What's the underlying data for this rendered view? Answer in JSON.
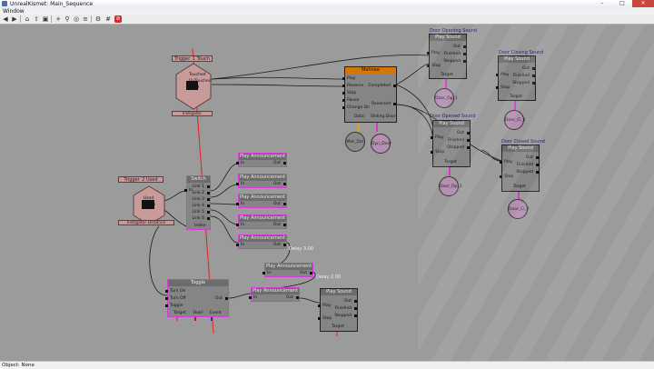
{
  "window": {
    "title": "UnrealKismet: Main_Sequence",
    "min_label": "–",
    "max_label": "□",
    "close_label": "✕"
  },
  "menu": {
    "window_label": "Window"
  },
  "toolbar": {
    "icons": [
      "back-icon",
      "forward-icon",
      "home-icon",
      "parent-icon",
      "open-icon",
      "zoom-in-icon",
      "search-icon",
      "find-icon",
      "settings-icon",
      "delete-icon"
    ]
  },
  "status": {
    "text": "Object: None"
  },
  "nodes": {
    "trigger1": {
      "label": "Trigger_1 Touch",
      "pins": [
        "Touched",
        "UnTouched",
        "Used"
      ],
      "bottom": "Instigator"
    },
    "trigger2": {
      "label": "Trigger_2 Used",
      "pins": [
        "Used",
        "Touch"
      ],
      "bottom": "Instigator     Distance"
    },
    "matinee": {
      "label": "Matinee",
      "in_pins": [
        "Play",
        "Reverse",
        "Stop",
        "Pause",
        "Change Dir"
      ],
      "out_pins": [
        "Completed",
        "Reversed"
      ],
      "vars": [
        "Data",
        "Sliding Door"
      ]
    },
    "switch": {
      "label": "Switch",
      "in_pins": [
        "In"
      ],
      "out_pins": [
        "Link 1",
        "Link 2",
        "Link 3",
        "Link 4",
        "Link 5",
        "Link 6"
      ],
      "bottom": "Index"
    },
    "toggle": {
      "label": "Toggle",
      "in_pins": [
        "Turn On",
        "Turn Off",
        "Toggle"
      ],
      "out_pins": [
        "Out"
      ],
      "vars": [
        "Target",
        "Bool",
        "Event"
      ]
    },
    "announce": [
      {
        "label": "Play Announcement",
        "in": "In",
        "out": "Out"
      },
      {
        "label": "Play Announcement",
        "in": "In",
        "out": "Out"
      },
      {
        "label": "Play Announcement",
        "in": "In",
        "out": "Out"
      },
      {
        "label": "Play Announcement",
        "in": "In",
        "out": "Out"
      },
      {
        "label": "Play Announcement",
        "in": "In",
        "out": "Out"
      },
      {
        "label": "Play Announcement",
        "in": "In",
        "out": "Out"
      },
      {
        "label": "Play Announcement",
        "in": "In",
        "out": "Out"
      }
    ],
    "sounds": [
      {
        "title": "Door Opening Sound",
        "label": "Play Sound",
        "in_pins": [
          "Play",
          "Stop"
        ],
        "out_pins": [
          "Out",
          "Finished",
          "Stopped"
        ],
        "target": "Target",
        "var": "Door_Op_1"
      },
      {
        "title": "Door Closing Sound",
        "label": "Play Sound",
        "in_pins": [
          "Play",
          "Stop"
        ],
        "out_pins": [
          "Out",
          "Finished",
          "Stopped"
        ],
        "target": "Target",
        "var": "Door_Cl_1"
      },
      {
        "title": "Door Opened Sound",
        "label": "Play Sound",
        "in_pins": [
          "Play",
          "Stop"
        ],
        "out_pins": [
          "Out",
          "Finished",
          "Stopped"
        ],
        "target": "Target",
        "var": "Door_Op_2"
      },
      {
        "title": "Door Closed Sound",
        "label": "Play Sound",
        "in_pins": [
          "Play",
          "Stop"
        ],
        "out_pins": [
          "Out",
          "Finished",
          "Stopped"
        ],
        "target": "Target",
        "var": "Door_Cl_2"
      },
      {
        "title": "",
        "label": "Play Sound",
        "in_pins": [
          "Play",
          "Stop"
        ],
        "out_pins": [
          "Out",
          "Finished",
          "Stopped"
        ],
        "target": "Target",
        "var": ""
      }
    ],
    "matinee_vars": [
      "Mat_Dat",
      "Dyn_Door"
    ],
    "delays": [
      "Delay 3.00",
      "Delay 2.00"
    ]
  },
  "colors": {
    "canvas": "#9b9b9b",
    "node_body": "#858585",
    "matinee_header": "#d4770b",
    "selection": "#d63ad8",
    "event_bar": "#c99a9a",
    "wire": "#1a1a1a",
    "red_wire": "#e22222"
  }
}
